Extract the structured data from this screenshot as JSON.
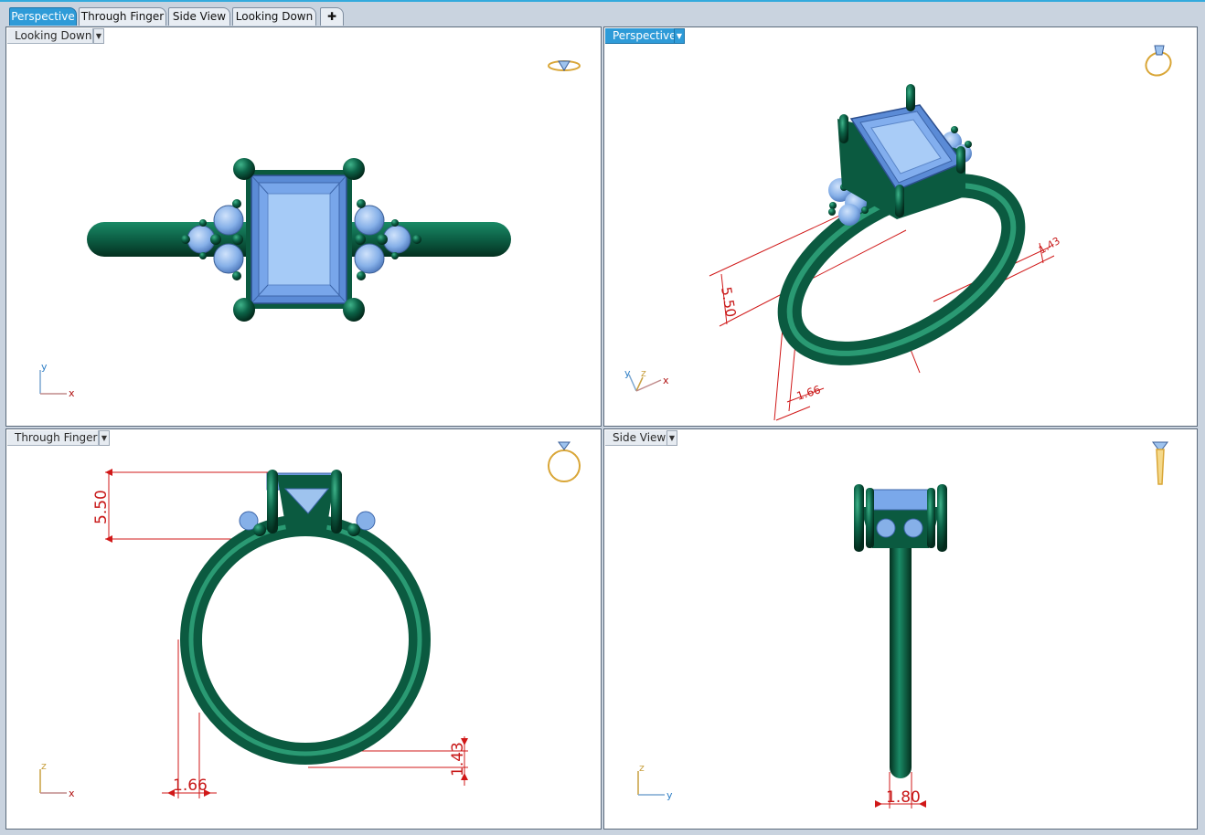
{
  "tabs": [
    {
      "label": "Perspective",
      "active": true
    },
    {
      "label": "Through Finger",
      "active": false
    },
    {
      "label": "Side View",
      "active": false
    },
    {
      "label": "Looking Down",
      "active": false
    }
  ],
  "add_tab_icon": "plus-icon",
  "viewports": {
    "top_left": {
      "title": "Looking Down",
      "axes": {
        "vertical": "y",
        "horizontal": "x"
      },
      "nav_icon": "ring-top-icon"
    },
    "top_right": {
      "title": "Perspective",
      "axes": {
        "vertical": "y",
        "depth": "z",
        "horizontal": "x"
      },
      "nav_icon": "ring-perspective-icon",
      "dimensions": {
        "height": "5.50",
        "width": "1.66",
        "thickness": "1.43"
      }
    },
    "bottom_left": {
      "title": "Through Finger",
      "axes": {
        "vertical": "z",
        "horizontal": "x"
      },
      "nav_icon": "ring-front-icon",
      "dimensions": {
        "height": "5.50",
        "width": "1.66",
        "thickness": "1.43"
      }
    },
    "bottom_right": {
      "title": "Side View",
      "axes": {
        "vertical": "z",
        "horizontal": "y"
      },
      "nav_icon": "ring-side-icon",
      "dimensions": {
        "width": "1.80"
      }
    }
  },
  "colors": {
    "metal": "#0f6b4e",
    "metal_dark": "#063a2a",
    "gem": "#86b6f2",
    "gem_dark": "#4a7ecb",
    "dimension": "#d01818",
    "active": "#2e9bd8",
    "axis_x": "#b01010",
    "axis_y": "#2f7fc6",
    "axis_z": "#c8a040"
  }
}
